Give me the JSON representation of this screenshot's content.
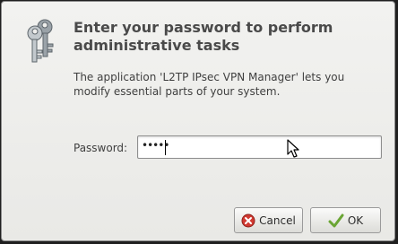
{
  "dialog": {
    "title": "Enter your password to perform administrative tasks",
    "message": "The application 'L2TP IPsec VPN Manager' lets you modify essential parts of your system.",
    "password_label": "Password:",
    "password_value": "•••••",
    "cancel_label": "Cancel",
    "ok_label": "OK",
    "icons": {
      "main": "keys-icon",
      "cancel": "cancel-icon",
      "ok": "checkmark-icon"
    },
    "colors": {
      "cancel_icon": "#d13a32",
      "ok_icon": "#6aa534"
    }
  }
}
